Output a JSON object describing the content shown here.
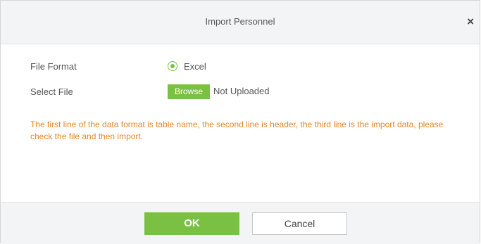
{
  "dialog": {
    "title": "Import Personnel",
    "close_symbol": "×"
  },
  "form": {
    "file_format_label": "File Format",
    "file_format_option": "Excel",
    "select_file_label": "Select File",
    "browse_label": "Browse",
    "upload_status": "Not Uploaded"
  },
  "hint": "The first line of the data format is table name, the second line is header, the third line is the import data, please check the file and then import.",
  "footer": {
    "ok_label": "OK",
    "cancel_label": "Cancel"
  },
  "colors": {
    "accent_green": "#7ac143",
    "hint_orange": "#e8852a",
    "header_bg": "#f3f4f6"
  },
  "icons": {
    "close": "close-icon",
    "radio": "radio-selected-icon"
  }
}
